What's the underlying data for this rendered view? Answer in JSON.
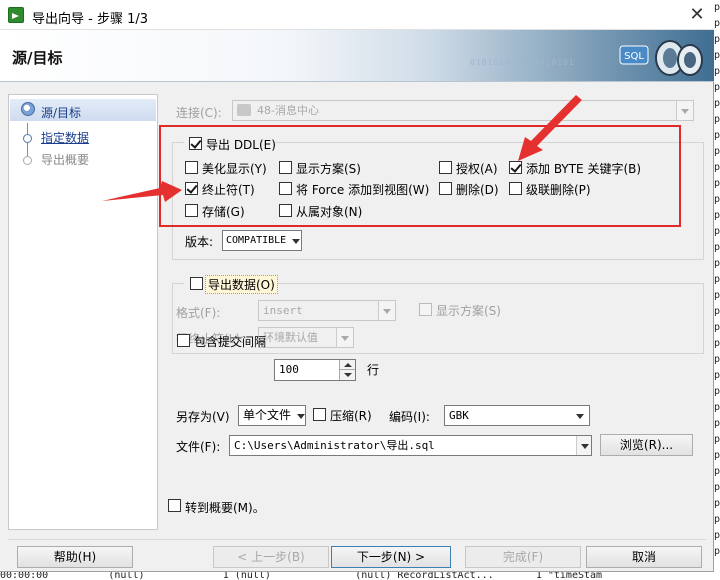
{
  "window": {
    "title": "导出向导 - 步骤 1/3",
    "close": "✕"
  },
  "header": {
    "title": "源/目标",
    "logo_text": "SQL",
    "binary_text": "010101010101010101"
  },
  "steps": [
    {
      "label": "源/目标",
      "state": "current"
    },
    {
      "label": "指定数据",
      "state": "link"
    },
    {
      "label": "导出概要",
      "state": "disabled"
    }
  ],
  "connection": {
    "label": "连接(C):",
    "value": "48-消息中心"
  },
  "ddl": {
    "export_label": "导出 DDL(E)",
    "export_checked": true,
    "options": [
      {
        "label": "美化显示(Y)",
        "checked": false
      },
      {
        "label": "显示方案(S)",
        "checked": false
      },
      {
        "label": "授权(A)",
        "checked": false
      },
      {
        "label": "添加 BYTE 关键字(B)",
        "checked": true
      },
      {
        "label": "终止符(T)",
        "checked": true
      },
      {
        "label": "将 Force 添加到视图(W)",
        "checked": false
      },
      {
        "label": "删除(D)",
        "checked": false
      },
      {
        "label": "级联删除(P)",
        "checked": false
      },
      {
        "label": "存储(G)",
        "checked": false
      },
      {
        "label": "从属对象(N)",
        "checked": false
      }
    ],
    "version_label": "版本:",
    "version_value": "COMPATIBLE"
  },
  "data_export": {
    "label": "导出数据(O)",
    "checked": false,
    "format_label": "格式(F):",
    "format_value": "insert",
    "show_schema_label": "显示方案(S)",
    "terminator_label": "行终止符(L):",
    "terminator_value": "环境默认值",
    "commit_label": "包含提交间隔",
    "commit_value": "100",
    "rows_label": "行"
  },
  "save": {
    "save_as_label": "另存为(V)",
    "save_as_value": "单个文件",
    "compress_label": "压缩(R)",
    "encoding_label": "编码(I):",
    "encoding_value": "GBK",
    "file_label": "文件(F):",
    "file_value": "C:\\Users\\Administrator\\导出.sql",
    "browse_label": "浏览(R)..."
  },
  "goto_summary": {
    "label": "转到概要(M)。",
    "checked": false
  },
  "buttons": {
    "help": "帮助(H)",
    "back": "< 上一步(B)",
    "next": "下一步(N) >",
    "finish": "完成(F)",
    "cancel": "取消"
  },
  "background": {
    "bottom_row": "00:00:00          (null)             1 (null)              (null) RecordListAct...       1 \"timeStam",
    "right_chars": [
      "p",
      "p",
      "p",
      "p",
      "p",
      "p",
      "p",
      "p",
      "p",
      "p",
      "p",
      "p",
      "p",
      "p",
      "p",
      "p",
      "p",
      "p",
      "p",
      "p",
      "p",
      "p",
      "p",
      "p",
      "p",
      "p",
      "p",
      "p",
      "p",
      "p",
      "p",
      "p",
      "p",
      "p",
      "p"
    ]
  },
  "colors": {
    "annotation": "#e02a2a",
    "link": "#1a3e8c"
  }
}
